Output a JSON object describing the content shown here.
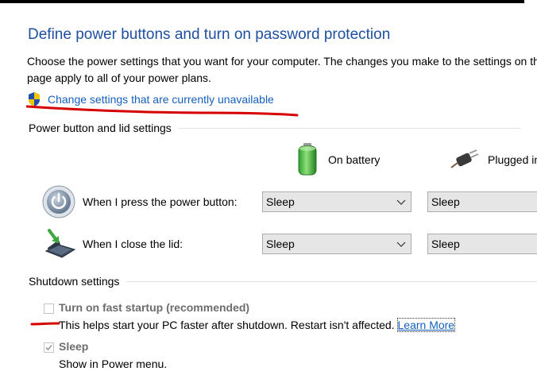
{
  "title": "Define power buttons and turn on password protection",
  "description_line1": "Choose the power settings that you want for your computer. The changes you make to the settings on this",
  "description_line2": "page apply to all of your power plans.",
  "change_settings_link": "Change settings that are currently unavailable",
  "power_lid_section": {
    "heading": "Power button and lid settings",
    "columns": {
      "battery": "On battery",
      "plugged": "Plugged in"
    },
    "rows": [
      {
        "label": "When I press the power button:",
        "battery_value": "Sleep",
        "plugged_value": "Sleep",
        "icon": "power-button-icon"
      },
      {
        "label": "When I close the lid:",
        "battery_value": "Sleep",
        "plugged_value": "Sleep",
        "icon": "laptop-lid-icon"
      }
    ]
  },
  "shutdown_section": {
    "heading": "Shutdown settings",
    "fast_startup": {
      "label": "Turn on fast startup (recommended)",
      "checked": false,
      "description": "This helps start your PC faster after shutdown. Restart isn't affected.",
      "learn_more": "Learn More"
    },
    "sleep": {
      "label": "Sleep",
      "checked": true,
      "description": "Show in Power menu."
    }
  },
  "colors": {
    "title": "#1e4fa0",
    "link": "#1560bd",
    "annotation": "#d60000",
    "disabled_text": "#6d6d6d"
  }
}
